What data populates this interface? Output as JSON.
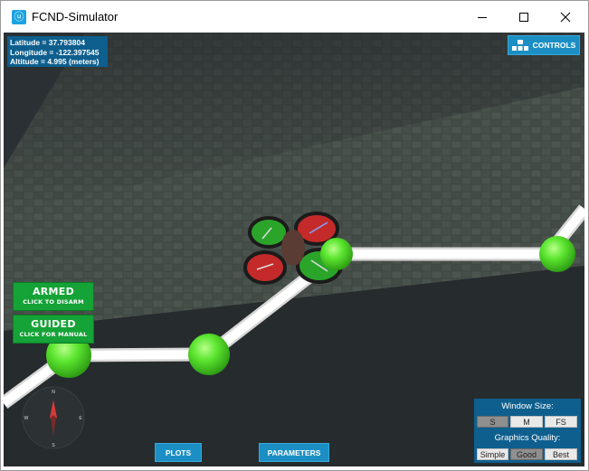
{
  "window": {
    "title": "FCND-Simulator",
    "app_icon_glyph": "ⓤ"
  },
  "gps": {
    "latitude": "Latitude = 37.793804",
    "longitude": "Longitude = -122.397545",
    "altitude": "Altitude = 4.995 (meters)"
  },
  "controls_button": {
    "label": "CONTROLS",
    "icon": "controls-blocks-icon"
  },
  "armed_button": {
    "title": "ARMED",
    "subtitle": "CLICK TO DISARM",
    "color": "#15a236"
  },
  "guided_button": {
    "title": "GUIDED",
    "subtitle": "CLICK FOR MANUAL",
    "color": "#15a236"
  },
  "compass": {
    "north": "N",
    "south": "S",
    "east": "E",
    "west": "W"
  },
  "bottom_buttons": {
    "plots": "PLOTS",
    "parameters": "PARAMETERS"
  },
  "window_size": {
    "title": "Window Size:",
    "options": [
      "S",
      "M",
      "FS"
    ],
    "selected": "S"
  },
  "graphics_quality": {
    "title": "Graphics Quality:",
    "options": [
      "Simple",
      "Good",
      "Best"
    ],
    "selected": "Good"
  },
  "colors": {
    "panel_blue": "#0e5f8e",
    "button_blue": "#1b8fc4",
    "status_green": "#15a236",
    "waypoint_green": "#5ce630",
    "rotor_red": "#c42a2a",
    "rotor_green": "#2aa52a"
  }
}
